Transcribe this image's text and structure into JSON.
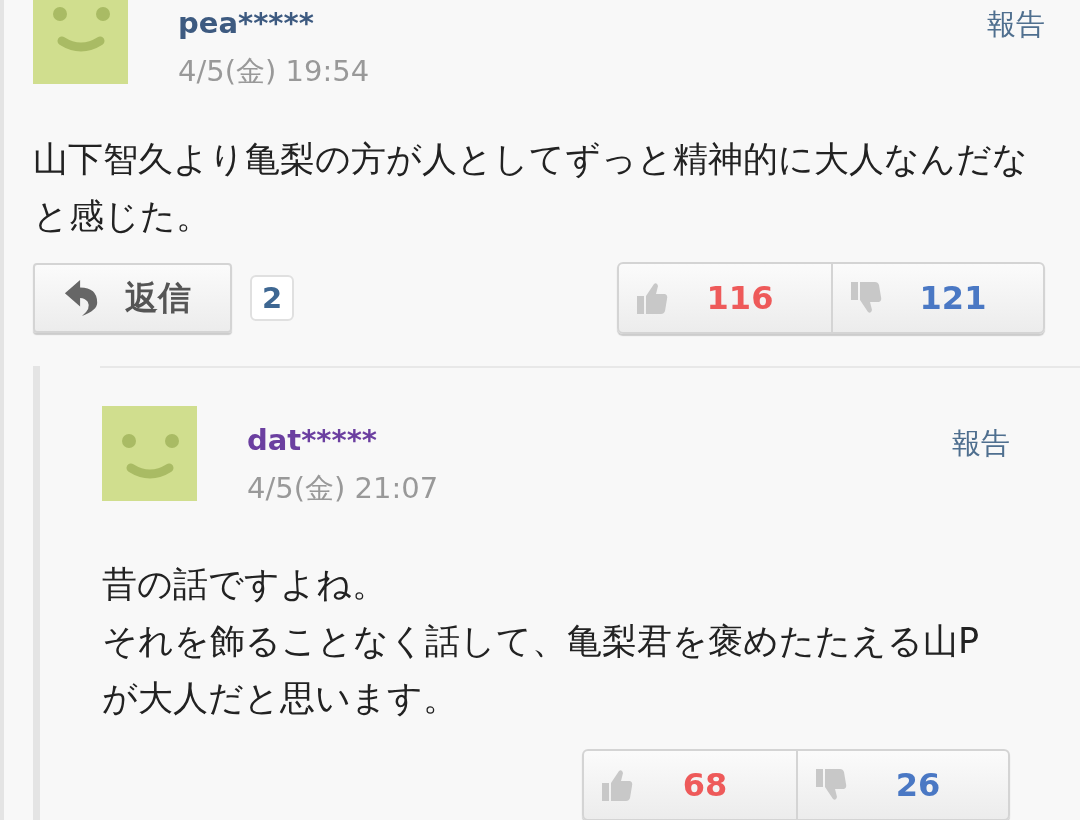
{
  "comments": [
    {
      "user": "pea*****",
      "color": "#3d5a80",
      "date": "4/5(金) 19:54",
      "report": "報告",
      "body": [
        "山下智久より亀梨の方が人としてずっと精神的に大人なんだなと感じた。"
      ],
      "reply_button": {
        "label": "返信",
        "count": "2"
      },
      "likes": "116",
      "dislikes": "121",
      "replies": [
        {
          "user": "dat*****",
          "color": "#6b3fa0",
          "date": "4/5(金) 21:07",
          "report": "報告",
          "body": [
            "昔の話ですよね。",
            "それを飾ることなく話して、亀梨君を褒めたたえる山Pが大人だと思います。"
          ],
          "likes": "68",
          "dislikes": "26"
        }
      ]
    }
  ]
}
